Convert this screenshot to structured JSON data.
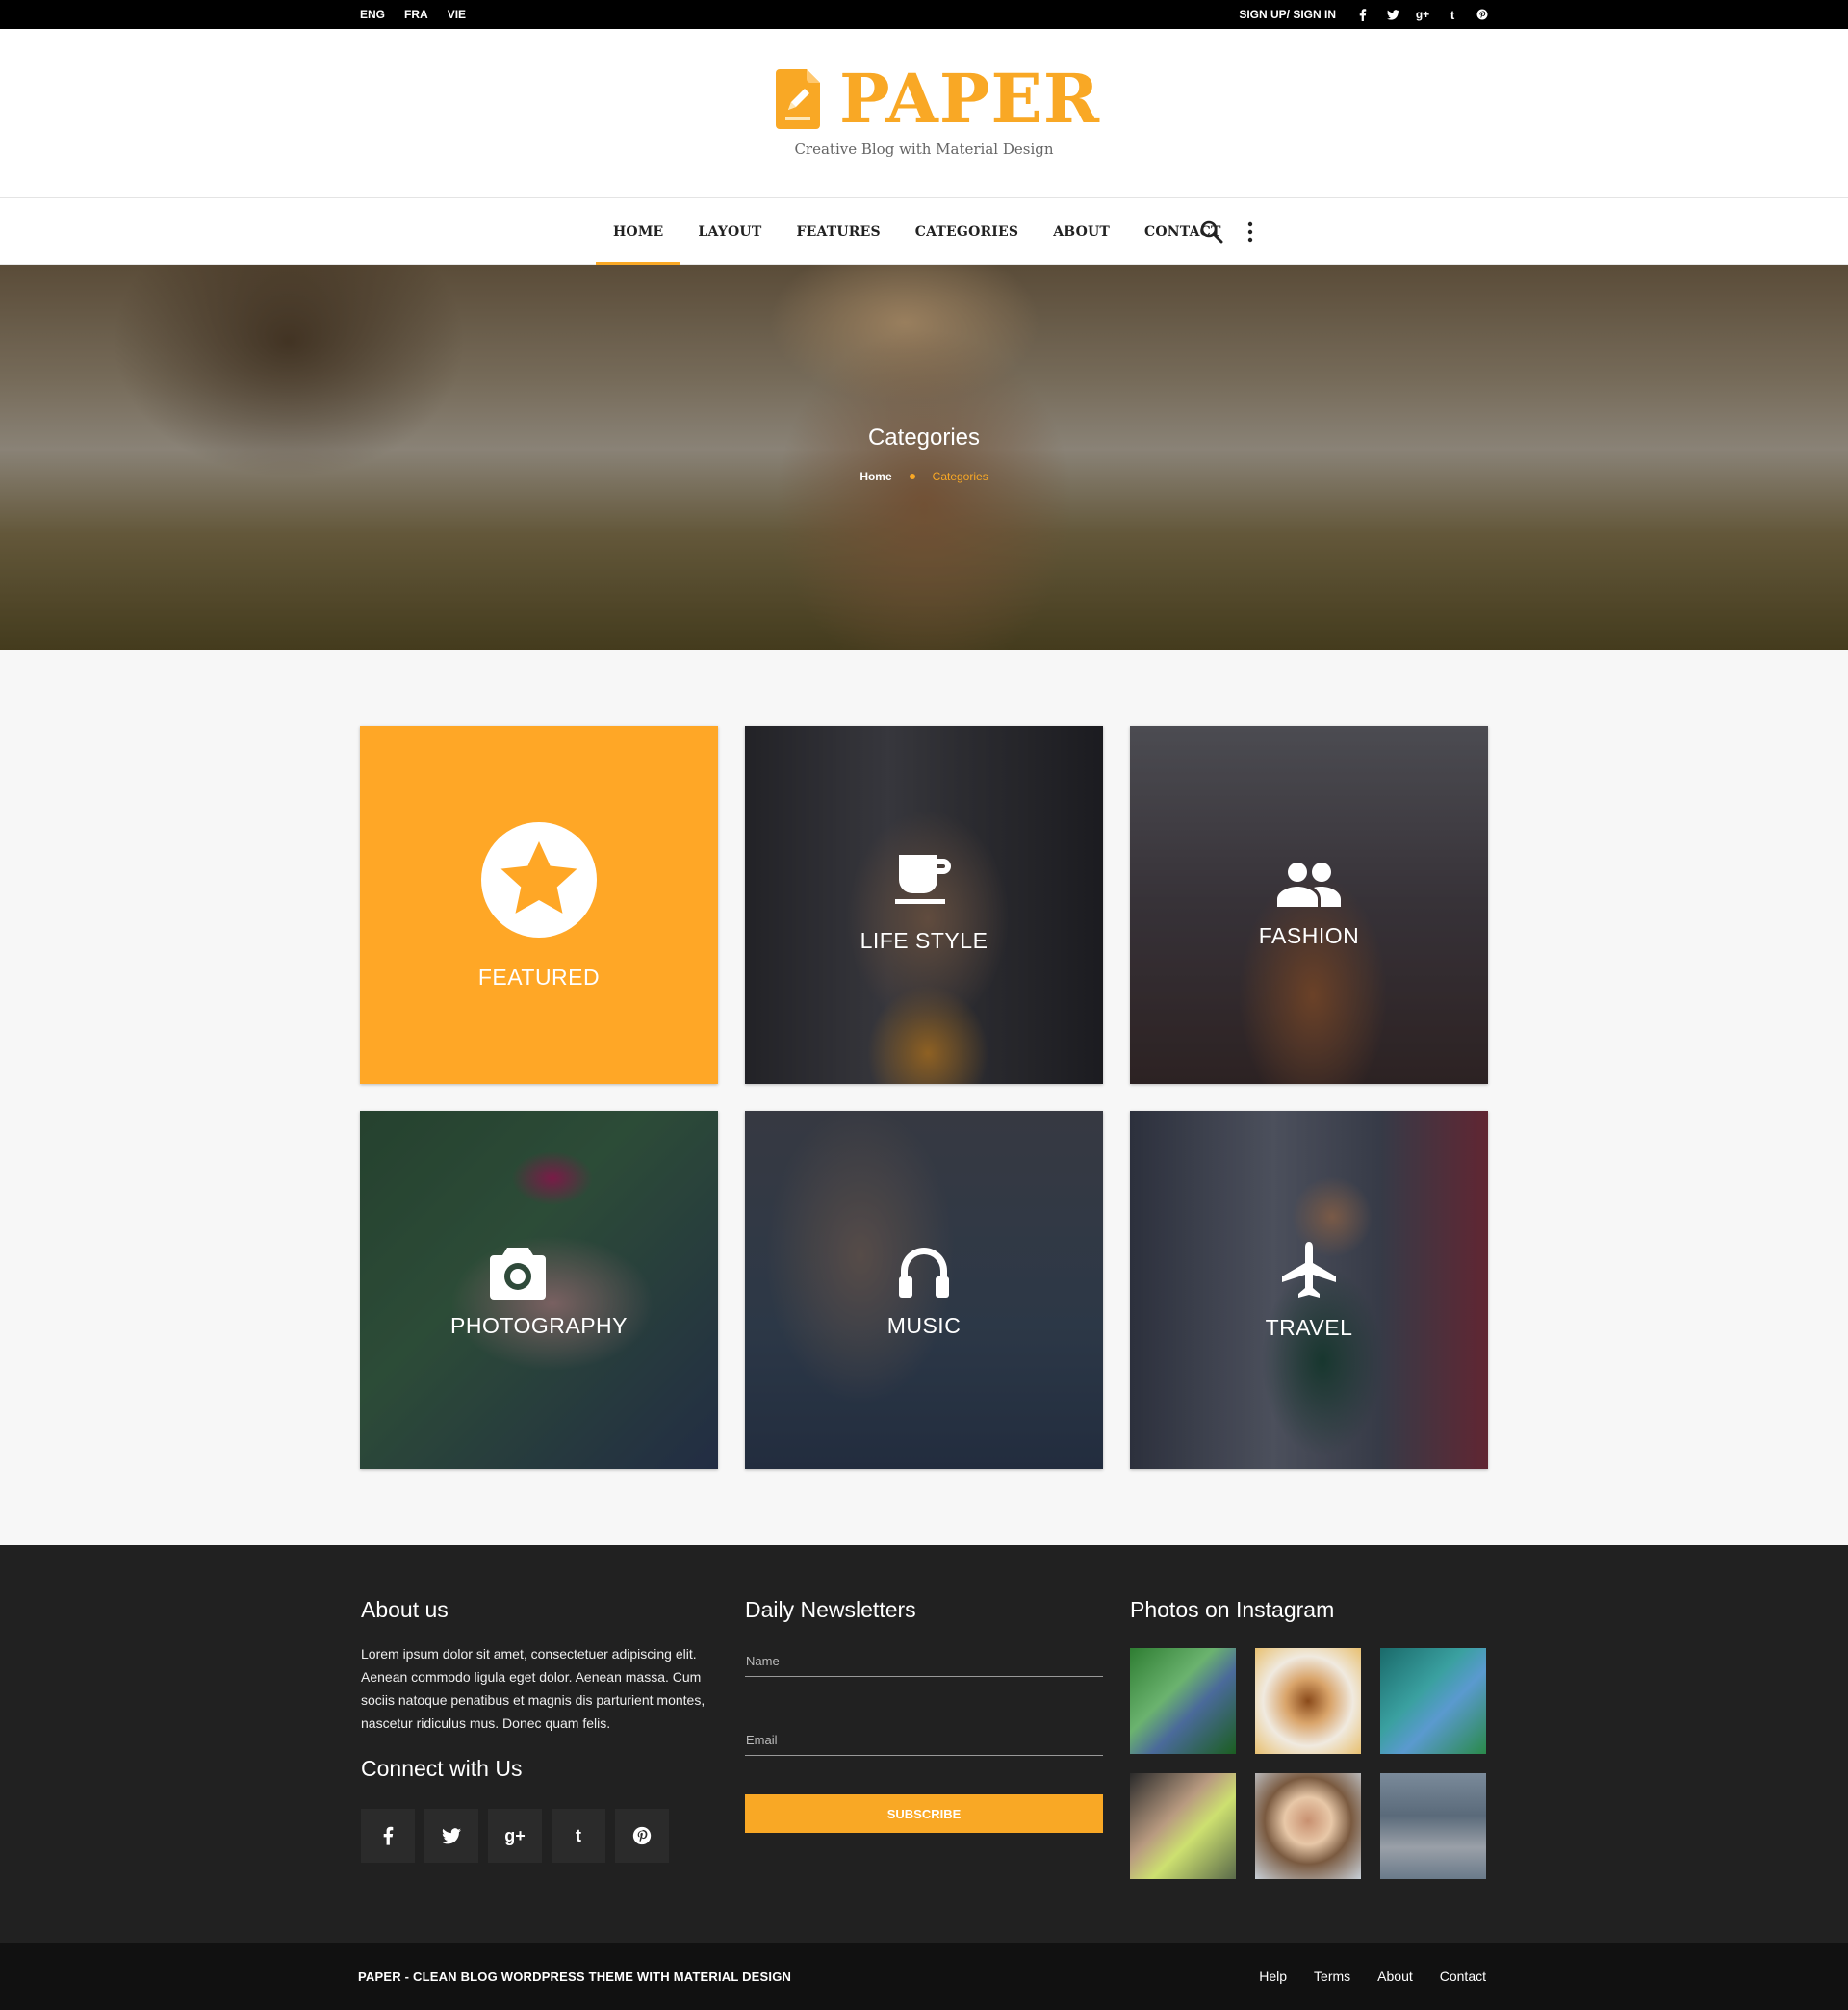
{
  "topbar": {
    "languages": [
      "ENG",
      "FRA",
      "VIE"
    ],
    "auth_label": "SIGN UP/ SIGN IN",
    "social_icons": [
      "facebook-icon",
      "twitter-icon",
      "google-plus-icon",
      "tumblr-icon",
      "pinterest-icon"
    ]
  },
  "brand": {
    "name": "PAPER",
    "tagline": "Creative Blog with Material Design",
    "accent_color": "#f9a825"
  },
  "nav": {
    "items": [
      "HOME",
      "LAYOUT",
      "FEATURES",
      "CATEGORIES",
      "ABOUT",
      "CONTACT"
    ],
    "active": "HOME"
  },
  "hero": {
    "title": "Categories",
    "breadcrumb": [
      "Home",
      "Categories"
    ]
  },
  "categories": [
    {
      "label": "FEATURED",
      "icon": "star-icon"
    },
    {
      "label": "LIFE STYLE",
      "icon": "coffee-cup-icon"
    },
    {
      "label": "FASHION",
      "icon": "people-icon"
    },
    {
      "label": "PHOTOGRAPHY",
      "icon": "camera-icon"
    },
    {
      "label": "MUSIC",
      "icon": "headphones-icon"
    },
    {
      "label": "TRAVEL",
      "icon": "airplane-icon"
    }
  ],
  "footer": {
    "about_title": "About us",
    "about_text": "Lorem ipsum dolor sit amet, consectetuer adipiscing elit. Aenean commodo ligula eget dolor. Aenean massa. Cum sociis natoque penatibus et magnis dis parturient montes, nascetur ridiculus mus. Donec quam felis.",
    "connect_title": "Connect with Us",
    "newsletter_title": "Daily Newsletters",
    "name_placeholder": "Name",
    "email_placeholder": "Email",
    "subscribe_label": "SUBSCRIBE",
    "instagram_title": "Photos on Instagram"
  },
  "bottom": {
    "copyright": "PAPER - CLEAN BLOG WORDPRESS THEME WITH MATERIAL DESIGN",
    "links": [
      "Help",
      "Terms",
      "About",
      "Contact"
    ]
  }
}
